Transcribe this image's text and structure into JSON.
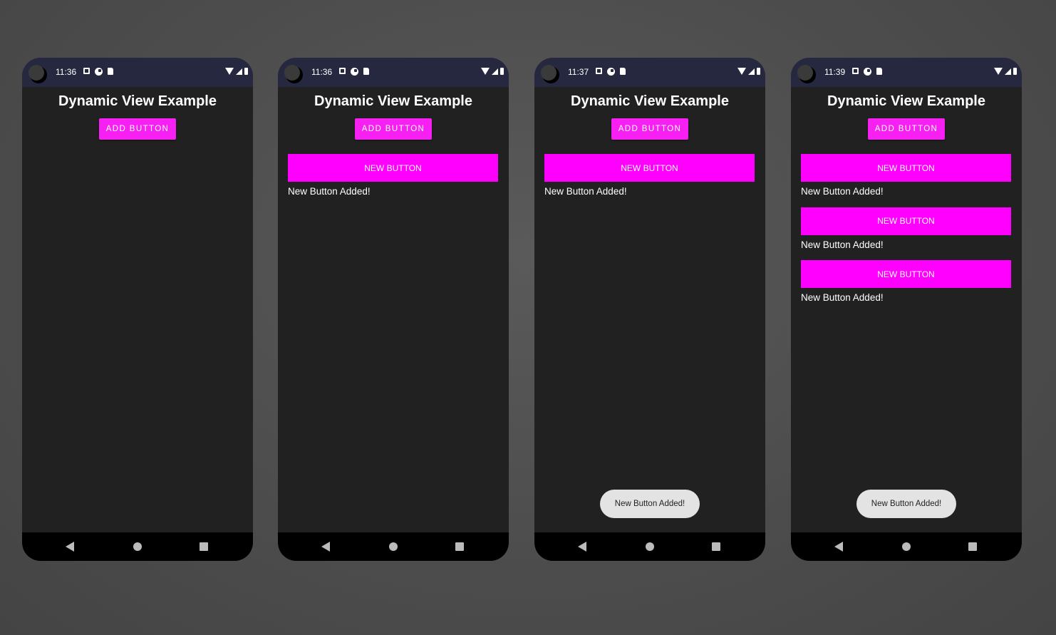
{
  "screens": [
    {
      "time": "11:36",
      "title": "Dynamic View Example",
      "add_button_label": "ADD BUTTON",
      "items": [],
      "toast": ""
    },
    {
      "time": "11:36",
      "title": "Dynamic View Example",
      "add_button_label": "ADD BUTTON",
      "items": [
        {
          "button_label": "NEW BUTTON",
          "text": "New Button Added!"
        }
      ],
      "toast": ""
    },
    {
      "time": "11:37",
      "title": "Dynamic View Example",
      "add_button_label": "ADD BUTTON",
      "items": [
        {
          "button_label": "NEW BUTTON",
          "text": "New Button Added!"
        }
      ],
      "toast": "New Button Added!"
    },
    {
      "time": "11:39",
      "title": "Dynamic View Example",
      "add_button_label": "ADD BUTTON",
      "items": [
        {
          "button_label": "NEW BUTTON",
          "text": "New Button Added!"
        },
        {
          "button_label": "NEW BUTTON",
          "text": "New Button Added!"
        },
        {
          "button_label": "NEW BUTTON",
          "text": "New Button Added!"
        }
      ],
      "toast": "New Button Added!"
    }
  ],
  "status_icons": [
    "notification-a-icon",
    "notification-g-icon",
    "sd-card-icon"
  ],
  "status_right_icons": [
    "wifi-icon",
    "cell-signal-icon",
    "battery-icon"
  ],
  "nav_icons": [
    "back-icon",
    "home-icon",
    "recents-icon"
  ],
  "colors": {
    "accent": "#ff00ff",
    "add_button": "#f720f2",
    "status_bar": "#262840",
    "screen_bg": "#212121",
    "toast_bg": "#e3e3e3"
  }
}
